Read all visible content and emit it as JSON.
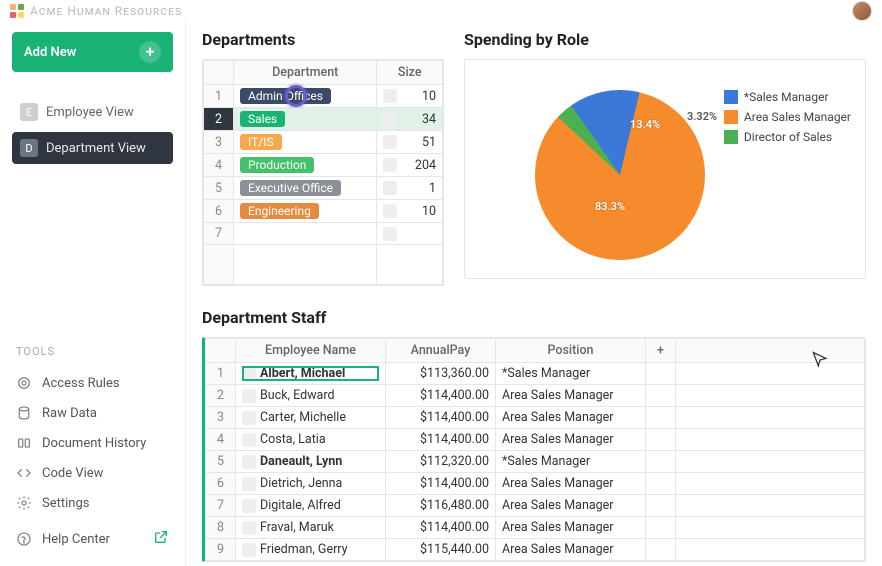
{
  "app_title": "Acme Human Resources",
  "add_button": "Add New",
  "views": [
    {
      "badge": "E",
      "label": "Employee View",
      "active": false
    },
    {
      "badge": "D",
      "label": "Department View",
      "active": true
    }
  ],
  "tools_label": "TOOLS",
  "tools": [
    {
      "icon": "shield-icon",
      "label": "Access Rules"
    },
    {
      "icon": "database-icon",
      "label": "Raw Data"
    },
    {
      "icon": "history-icon",
      "label": "Document History"
    },
    {
      "icon": "code-icon",
      "label": "Code View"
    },
    {
      "icon": "gear-icon",
      "label": "Settings"
    }
  ],
  "help_label": "Help Center",
  "departments": {
    "title": "Departments",
    "headers": [
      "Department",
      "Size"
    ],
    "rows": [
      {
        "name": "Admin Offices",
        "color": "#3b4a66",
        "size": 10
      },
      {
        "name": "Sales",
        "color": "#19b375",
        "size": 34
      },
      {
        "name": "IT/IS",
        "color": "#f6a94c",
        "size": 51
      },
      {
        "name": "Production",
        "color": "#45c06b",
        "size": 204
      },
      {
        "name": "Executive Office",
        "color": "#8a8f98",
        "size": 1
      },
      {
        "name": "Engineering",
        "color": "#e68a3e",
        "size": 10
      }
    ],
    "selected_row": 2
  },
  "chart_data": {
    "type": "pie",
    "title": "Spending by Role",
    "series": [
      {
        "name": "*Sales Manager",
        "value": 13.4,
        "color": "#3b78d8"
      },
      {
        "name": "Area Sales Manager",
        "value": 83.3,
        "color": "#f58b2c"
      },
      {
        "name": "Director of Sales",
        "value": 3.32,
        "color": "#4caf50"
      }
    ]
  },
  "staff": {
    "title": "Department Staff",
    "headers": [
      "Employee Name",
      "AnnualPay",
      "Position"
    ],
    "add_col": "+",
    "rows": [
      {
        "name": "Albert, Michael",
        "pay": "$113,360.00",
        "pos": "*Sales Manager",
        "bold": true
      },
      {
        "name": "Buck, Edward",
        "pay": "$114,400.00",
        "pos": "Area Sales Manager"
      },
      {
        "name": "Carter, Michelle",
        "pay": "$114,400.00",
        "pos": "Area Sales Manager"
      },
      {
        "name": "Costa, Latia",
        "pay": "$114,400.00",
        "pos": "Area Sales Manager"
      },
      {
        "name": "Daneault, Lynn",
        "pay": "$112,320.00",
        "pos": "*Sales Manager",
        "bold": true
      },
      {
        "name": "Dietrich, Jenna",
        "pay": "$114,400.00",
        "pos": "Area Sales Manager"
      },
      {
        "name": "Digitale, Alfred",
        "pay": "$116,480.00",
        "pos": "Area Sales Manager"
      },
      {
        "name": "Fraval, Maruk",
        "pay": "$114,400.00",
        "pos": "Area Sales Manager"
      },
      {
        "name": "Friedman, Gerry",
        "pay": "$115,440.00",
        "pos": "Area Sales Manager"
      }
    ]
  }
}
